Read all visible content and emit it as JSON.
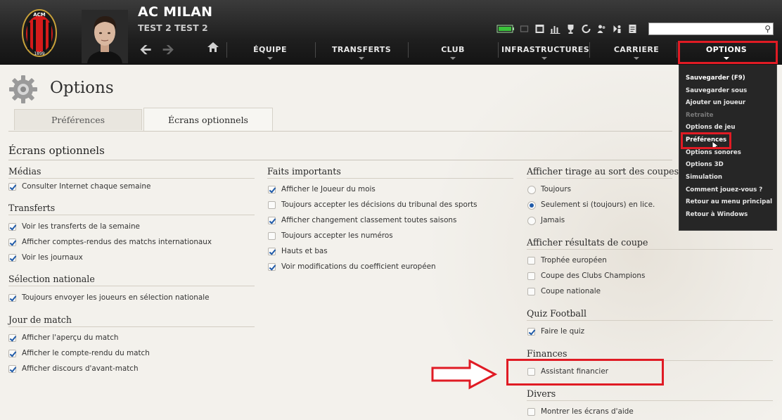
{
  "header": {
    "club_name": "AC MILAN",
    "manager_name": "TEST 2 TEST 2",
    "crest_text": "ACM",
    "crest_year": "1899",
    "icons": [
      "battery-icon",
      "window-icon",
      "calendar-icon",
      "chart-icon",
      "trophy-icon",
      "refresh-icon",
      "people-icon",
      "stadium-icon",
      "document-icon"
    ],
    "search": {
      "value": "",
      "placeholder": ""
    },
    "nav": {
      "back": "back-arrow-icon",
      "forward": "forward-arrow-icon",
      "home": "home-icon",
      "items": [
        "ÉQUIPE",
        "TRANSFERTS",
        "CLUB",
        "INFRASTRUCTURES",
        "CARRIERE",
        "OPTIONS"
      ]
    },
    "colors": {
      "header_bg": "#1f1f1f",
      "highlight_red": "#e01b24"
    }
  },
  "dropdown": {
    "items": [
      {
        "label": "Sauvegarder (F9)",
        "state": "normal"
      },
      {
        "label": "Sauvegarder sous",
        "state": "normal"
      },
      {
        "label": "Ajouter un joueur",
        "state": "normal"
      },
      {
        "label": "Retraite",
        "state": "disabled"
      },
      {
        "label": "Options de jeu",
        "state": "normal"
      },
      {
        "label": "Préférences",
        "state": "hover"
      },
      {
        "label": "Options sonores",
        "state": "normal"
      },
      {
        "label": "Options 3D",
        "state": "normal"
      },
      {
        "label": "Simulation",
        "state": "normal"
      },
      {
        "label": "Comment jouez-vous ?",
        "state": "normal"
      },
      {
        "label": "Retour au menu principal",
        "state": "normal"
      },
      {
        "label": "Retour à Windows",
        "state": "normal"
      }
    ]
  },
  "page": {
    "title": "Options",
    "tabs": [
      {
        "label": "Préférences",
        "active": false
      },
      {
        "label": "Écrans optionnels",
        "active": true
      }
    ],
    "section_title": "Écrans optionnels"
  },
  "groups": {
    "medias": {
      "title": "Médias",
      "items": [
        {
          "label": "Consulter Internet chaque semaine",
          "checked": true
        }
      ]
    },
    "transferts": {
      "title": "Transferts",
      "items": [
        {
          "label": "Voir les transferts de la semaine",
          "checked": true
        },
        {
          "label": "Afficher comptes-rendus des matchs internationaux",
          "checked": true
        },
        {
          "label": "Voir les journaux",
          "checked": true
        }
      ]
    },
    "selection": {
      "title": "Sélection nationale",
      "items": [
        {
          "label": "Toujours envoyer les joueurs en sélection nationale",
          "checked": true
        }
      ]
    },
    "jour_match": {
      "title": "Jour de match",
      "items": [
        {
          "label": "Afficher l'aperçu du match",
          "checked": true
        },
        {
          "label": "Afficher le compte-rendu du match",
          "checked": true
        },
        {
          "label": "Afficher discours d'avant-match",
          "checked": true
        }
      ]
    },
    "faits": {
      "title": "Faits importants",
      "items": [
        {
          "label": "Afficher le Joueur du mois",
          "checked": true
        },
        {
          "label": "Toujours accepter les décisions du tribunal des sports",
          "checked": false
        },
        {
          "label": "Afficher changement classement toutes saisons",
          "checked": true
        },
        {
          "label": "Toujours accepter les numéros",
          "checked": false
        },
        {
          "label": "Hauts et bas",
          "checked": true
        },
        {
          "label": "Voir modifications du coefficient européen",
          "checked": true
        }
      ]
    },
    "tirage": {
      "title": "Afficher tirage au sort des coupes",
      "options": [
        {
          "label": "Toujours",
          "selected": false
        },
        {
          "label": "Seulement si (toujours) en lice.",
          "selected": true
        },
        {
          "label": "Jamais",
          "selected": false
        }
      ]
    },
    "resultats": {
      "title": "Afficher résultats de coupe",
      "items": [
        {
          "label": "Trophée européen",
          "checked": false
        },
        {
          "label": "Coupe des Clubs Champions",
          "checked": false
        },
        {
          "label": "Coupe nationale",
          "checked": false
        }
      ]
    },
    "quiz": {
      "title": "Quiz Football",
      "items": [
        {
          "label": "Faire le quiz",
          "checked": true
        }
      ]
    },
    "finances": {
      "title": "Finances",
      "items": [
        {
          "label": "Assistant financier",
          "checked": false
        }
      ]
    },
    "divers": {
      "title": "Divers",
      "items": [
        {
          "label": "Montrer les écrans d'aide",
          "checked": false
        }
      ]
    }
  }
}
